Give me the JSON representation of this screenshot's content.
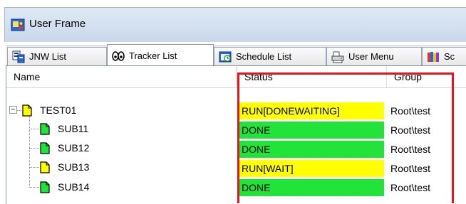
{
  "window": {
    "title": "User Frame"
  },
  "tabs": [
    {
      "label": "JNW List",
      "icon": "jnw-list-icon"
    },
    {
      "label": "Tracker List",
      "icon": "tracker-list-icon",
      "active": true
    },
    {
      "label": "Schedule List",
      "icon": "schedule-list-icon"
    },
    {
      "label": "User Menu",
      "icon": "user-menu-icon"
    },
    {
      "label": "Sc",
      "icon": "schedule-calendar-icon"
    }
  ],
  "columns": {
    "name": "Name",
    "status": "Status",
    "group": "Group"
  },
  "rows": [
    {
      "name": "TEST01",
      "status": "RUN[DONEWAITING]",
      "group": "Root\\test",
      "status_color": "#ffff00",
      "icon_color": "#ffff00",
      "level": 0
    },
    {
      "name": "SUB11",
      "status": "DONE",
      "group": "Root\\test",
      "status_color": "#22e33a",
      "icon_color": "#22e33a",
      "level": 1
    },
    {
      "name": "SUB12",
      "status": "DONE",
      "group": "Root\\test",
      "status_color": "#22e33a",
      "icon_color": "#22e33a",
      "level": 1
    },
    {
      "name": "SUB13",
      "status": "RUN[WAIT]",
      "group": "Root\\test",
      "status_color": "#ffff00",
      "icon_color": "#ffff00",
      "level": 1
    },
    {
      "name": "SUB14",
      "status": "DONE",
      "group": "Root\\test",
      "status_color": "#22e33a",
      "icon_color": "#22e33a",
      "level": 1
    }
  ],
  "expander_symbol": "−"
}
